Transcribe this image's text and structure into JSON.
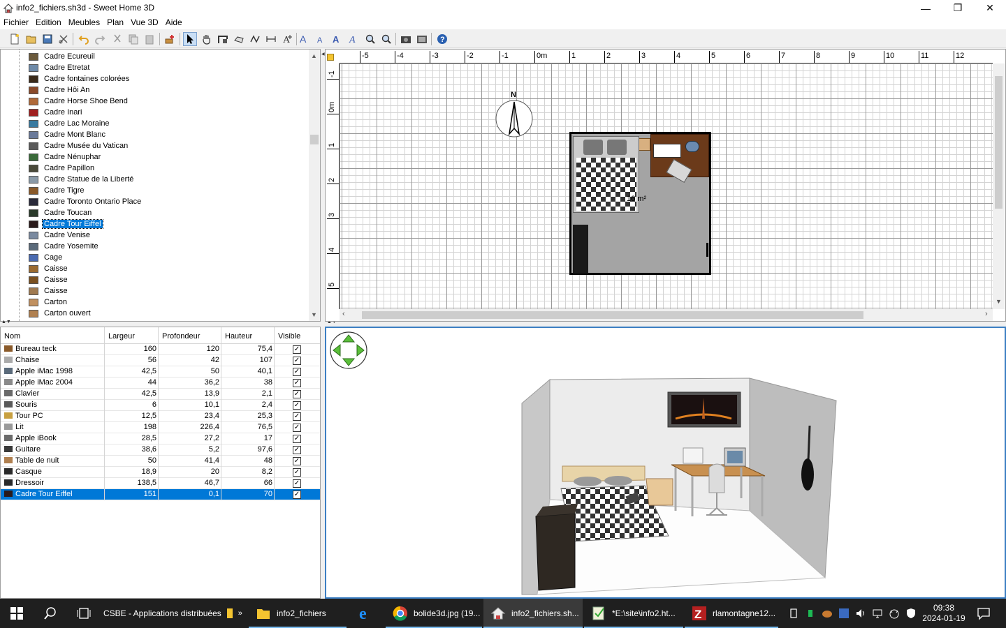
{
  "window": {
    "title": "info2_fichiers.sh3d - Sweet Home 3D",
    "minimize": "—",
    "maximize": "❐",
    "close": "✕"
  },
  "menu": [
    "Fichier",
    "Edition",
    "Meubles",
    "Plan",
    "Vue 3D",
    "Aide"
  ],
  "toolbar_icons": [
    "new-file-icon",
    "open-icon",
    "save-icon",
    "cut-tool-icon",
    "undo-icon",
    "redo-icon",
    "cut-icon",
    "copy-icon",
    "paste-icon",
    "add-furniture-icon",
    "select-mode-icon",
    "pan-mode-icon",
    "create-walls-icon",
    "create-rooms-icon",
    "create-polylines-icon",
    "create-dimensions-icon",
    "add-text-icon",
    "increase-text-icon",
    "decrease-text-icon",
    "bold-text-icon",
    "italic-text-icon",
    "zoom-in-icon",
    "zoom-out-icon",
    "create-photo-icon",
    "create-video-icon",
    "help-icon"
  ],
  "catalog": {
    "items": [
      {
        "label": "Cadre Ecureuil",
        "color": "#6b5a3c"
      },
      {
        "label": "Cadre Etretat",
        "color": "#6e8aa8"
      },
      {
        "label": "Cadre fontaines colorées",
        "color": "#3a2a1a"
      },
      {
        "label": "Cadre Hôi An",
        "color": "#8a4a2a"
      },
      {
        "label": "Cadre Horse Shoe Bend",
        "color": "#b06a3a"
      },
      {
        "label": "Cadre Inari",
        "color": "#a02020"
      },
      {
        "label": "Cadre Lac Moraine",
        "color": "#3a7aa0"
      },
      {
        "label": "Cadre Mont Blanc",
        "color": "#6a7a9a"
      },
      {
        "label": "Cadre Musée du Vatican",
        "color": "#5a5a5a"
      },
      {
        "label": "Cadre Nénuphar",
        "color": "#3a6a3a"
      },
      {
        "label": "Cadre Papillon",
        "color": "#4a4a3a"
      },
      {
        "label": "Cadre Statue de la Liberté",
        "color": "#8a9aa8"
      },
      {
        "label": "Cadre Tigre",
        "color": "#8a5a2a"
      },
      {
        "label": "Cadre Toronto Ontario Place",
        "color": "#2a2a3a"
      },
      {
        "label": "Cadre Toucan",
        "color": "#2a3a2a"
      },
      {
        "label": "Cadre Tour Eiffel",
        "color": "#2a1a1a",
        "selected": true
      },
      {
        "label": "Cadre Venise",
        "color": "#7a8aa0"
      },
      {
        "label": "Cadre Yosemite",
        "color": "#5a6a7a"
      },
      {
        "label": "Cage",
        "color": "#4a6ab0"
      },
      {
        "label": "Caisse",
        "color": "#9a6a30"
      },
      {
        "label": "Caisse",
        "color": "#7a5020"
      },
      {
        "label": "Caisse",
        "color": "#a07a50"
      },
      {
        "label": "Carton",
        "color": "#c09060"
      },
      {
        "label": "Carton ouvert",
        "color": "#b08050"
      }
    ]
  },
  "furniture": {
    "headers": [
      "Nom",
      "Largeur",
      "Profondeur",
      "Hauteur",
      "Visible"
    ],
    "rows": [
      {
        "name": "Bureau teck",
        "width": "160",
        "depth": "120",
        "height": "75,4",
        "visible": true,
        "icon": "#8a5a2a"
      },
      {
        "name": "Chaise",
        "width": "56",
        "depth": "42",
        "height": "107",
        "visible": true,
        "icon": "#aaaaaa"
      },
      {
        "name": "Apple iMac 1998",
        "width": "42,5",
        "depth": "50",
        "height": "40,1",
        "visible": true,
        "icon": "#5a6a7a"
      },
      {
        "name": "Apple iMac 2004",
        "width": "44",
        "depth": "36,2",
        "height": "38",
        "visible": true,
        "icon": "#8a8a8a"
      },
      {
        "name": "Clavier",
        "width": "42,5",
        "depth": "13,9",
        "height": "2,1",
        "visible": true,
        "icon": "#6a6a6a"
      },
      {
        "name": "Souris",
        "width": "6",
        "depth": "10,1",
        "height": "2,4",
        "visible": true,
        "icon": "#5a5a5a"
      },
      {
        "name": "Tour PC",
        "width": "12,5",
        "depth": "23,4",
        "height": "25,3",
        "visible": true,
        "icon": "#c8a040"
      },
      {
        "name": "Lit",
        "width": "198",
        "depth": "226,4",
        "height": "76,5",
        "visible": true,
        "icon": "#9a9a9a"
      },
      {
        "name": "Apple iBook",
        "width": "28,5",
        "depth": "27,2",
        "height": "17",
        "visible": true,
        "icon": "#6a6a6a"
      },
      {
        "name": "Guitare",
        "width": "38,6",
        "depth": "5,2",
        "height": "97,6",
        "visible": true,
        "icon": "#3a3a3a"
      },
      {
        "name": "Table de nuit",
        "width": "50",
        "depth": "41,4",
        "height": "48",
        "visible": true,
        "icon": "#b08050"
      },
      {
        "name": "Casque",
        "width": "18,9",
        "depth": "20",
        "height": "8,2",
        "visible": true,
        "icon": "#2a2a2a"
      },
      {
        "name": "Dressoir",
        "width": "138,5",
        "depth": "46,7",
        "height": "66",
        "visible": true,
        "icon": "#2a2a2a"
      },
      {
        "name": "Cadre Tour Eiffel",
        "width": "151",
        "depth": "0,1",
        "height": "70",
        "visible": true,
        "icon": "#2a1a1a",
        "selected": true
      }
    ]
  },
  "plan": {
    "ruler_h": [
      "-5",
      "-4",
      "-3",
      "-2",
      "-1",
      "0m",
      "1",
      "2",
      "3",
      "4",
      "5",
      "6",
      "7",
      "8",
      "9",
      "10",
      "11",
      "12"
    ],
    "ruler_v": [
      "-1",
      "0m",
      "1",
      "2",
      "3",
      "4",
      "5"
    ],
    "compass_label": "N",
    "room_area": "16 m²"
  },
  "taskbar": {
    "items": [
      {
        "label": "CSBE - Applications distribuées",
        "icon": "folder-icon"
      },
      {
        "label": "info2_fichiers",
        "icon": "folder-icon"
      },
      {
        "label": "",
        "icon": "internet-explorer-icon"
      },
      {
        "label": "bolide3d.jpg (19...",
        "icon": "chrome-icon"
      },
      {
        "label": "info2_fichiers.sh...",
        "icon": "sweet-home-3d-icon"
      },
      {
        "label": "*E:\\site\\info2.ht...",
        "icon": "notepad-plus-icon"
      },
      {
        "label": "rlamontagne12...",
        "icon": "filezilla-icon"
      }
    ],
    "overflow": "»",
    "time": "09:38",
    "date": "2024-01-19"
  },
  "colors": {
    "selection": "#0078d7",
    "taskbar": "#1f1f1f",
    "view3d_border": "#3c7fc3"
  }
}
